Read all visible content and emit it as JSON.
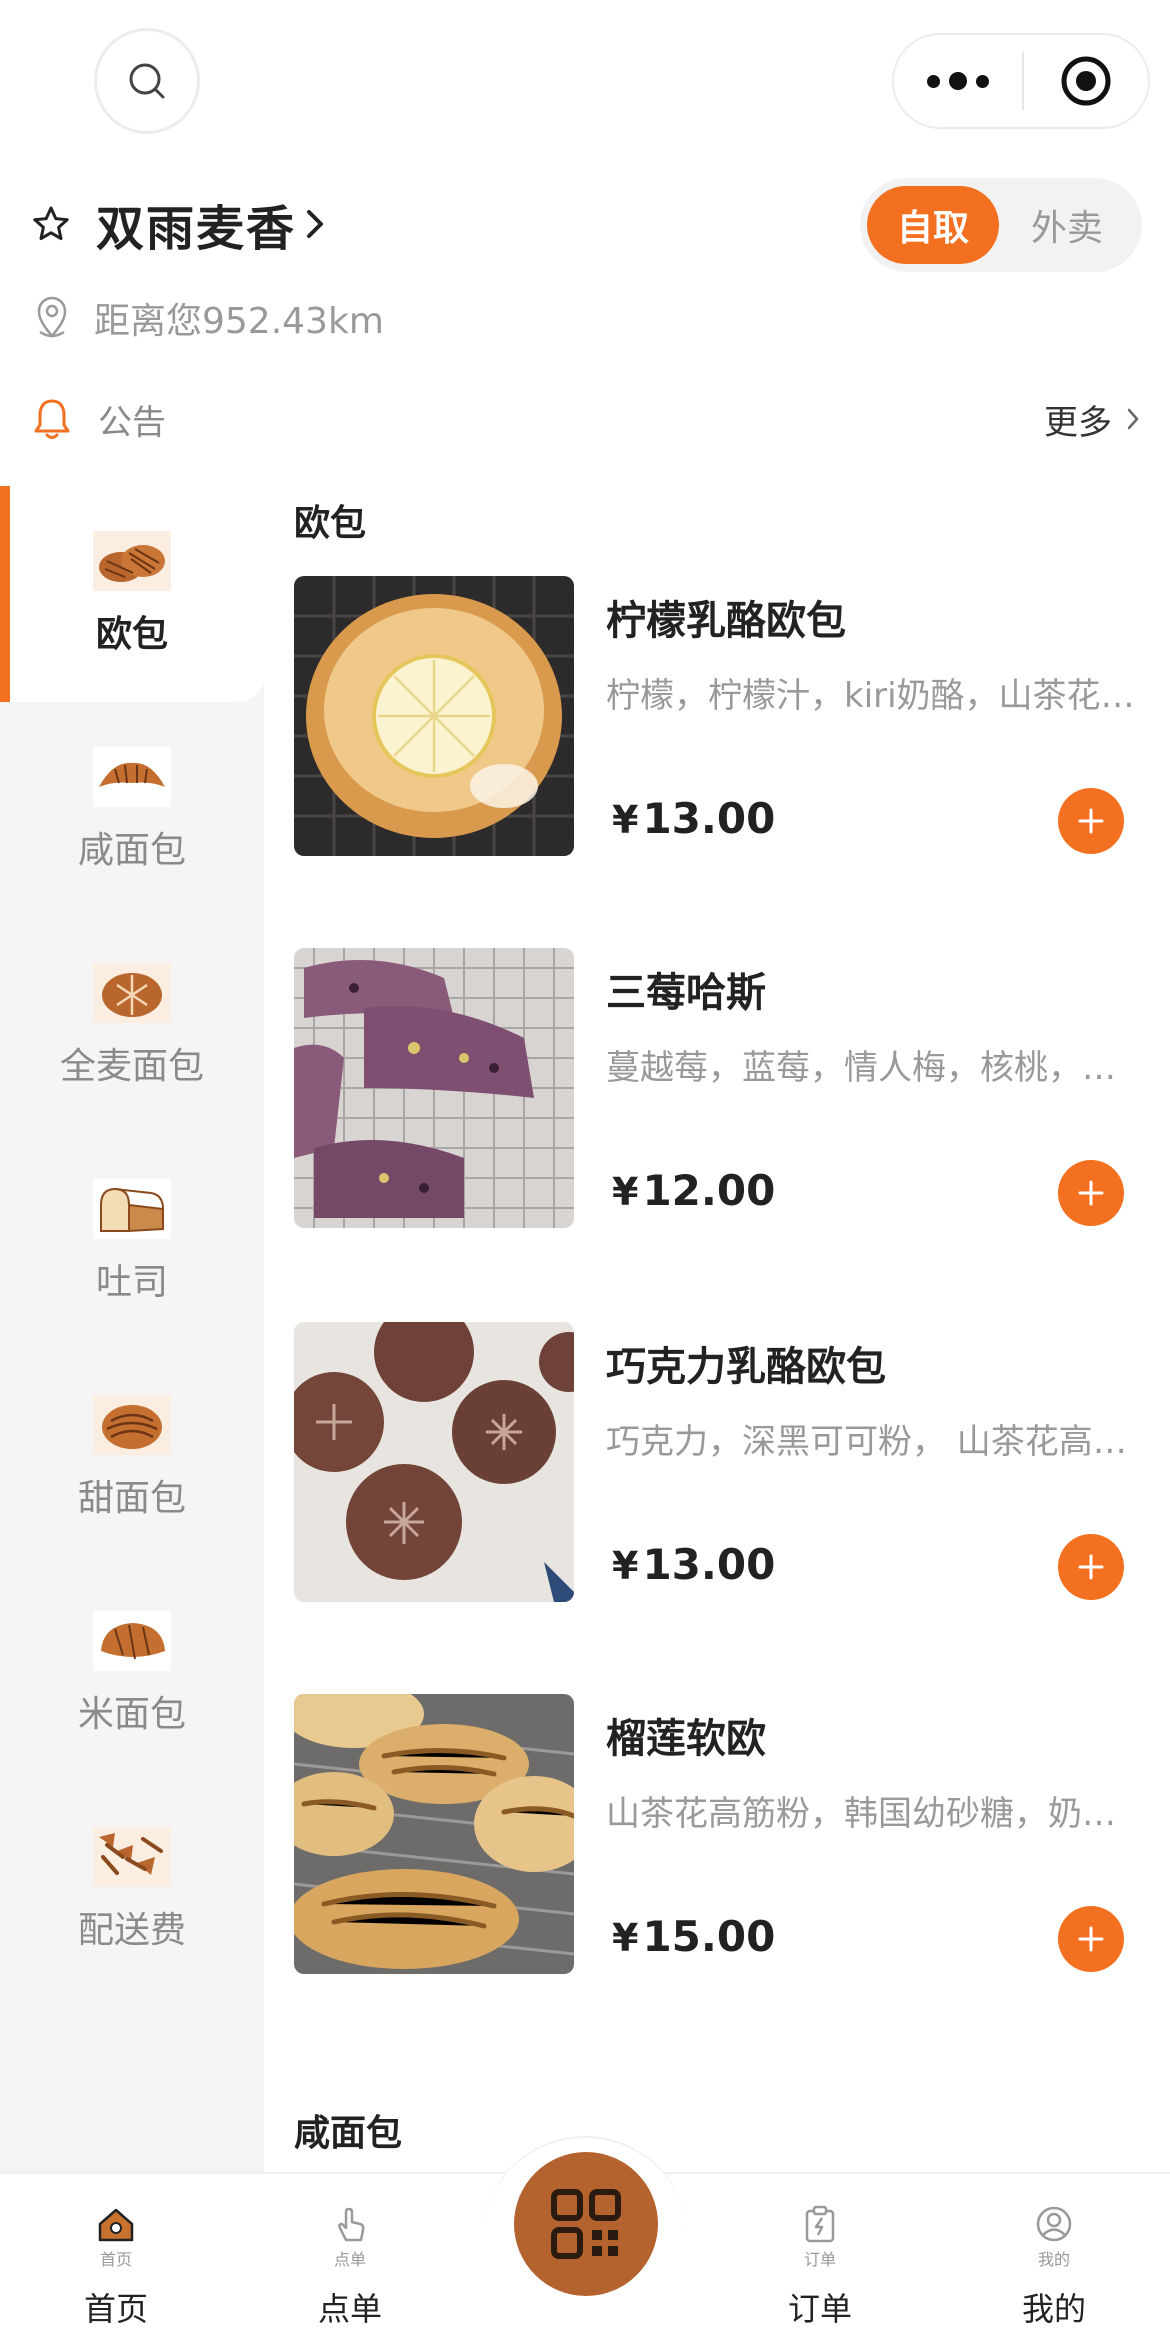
{
  "header": {
    "search_icon": "search-icon",
    "more_icon": "more-dots-icon",
    "close_icon": "target-icon"
  },
  "shop": {
    "name": "双雨麦香",
    "distance": "距离您952.43km",
    "mode_selected": "自取",
    "mode_other": "外卖",
    "notice_label": "公告",
    "notice_more": "更多"
  },
  "sidebar": {
    "items": [
      {
        "label": "欧包",
        "icon": "european-bread-icon",
        "active": true
      },
      {
        "label": "咸面包",
        "icon": "croissant-icon",
        "active": false
      },
      {
        "label": "全麦面包",
        "icon": "whole-wheat-loaf-icon",
        "active": false
      },
      {
        "label": "吐司",
        "icon": "toast-loaf-icon",
        "active": false
      },
      {
        "label": "甜面包",
        "icon": "sweet-bun-icon",
        "active": false
      },
      {
        "label": "米面包",
        "icon": "rice-bread-icon",
        "active": false
      },
      {
        "label": "配送费",
        "icon": "delivery-fee-icon",
        "active": false
      }
    ]
  },
  "sections": [
    {
      "title": "欧包",
      "products": [
        {
          "name": "柠檬乳酪欧包",
          "desc": "柠檬，柠檬汁，kiri奶酪，山茶花高筋粉",
          "currency": "¥",
          "price": "13.00"
        },
        {
          "name": "三莓哈斯",
          "desc": "蔓越莓，蓝莓，情人梅，核桃，全麦粉",
          "currency": "¥",
          "price": "12.00"
        },
        {
          "name": "巧克力乳酪欧包",
          "desc": "巧克力，深黑可可粉， 山茶花高筋粉",
          "currency": "¥",
          "price": "13.00"
        },
        {
          "name": "榴莲软欧",
          "desc": "山茶花高筋粉，韩国幼砂糖，奶油奶酪",
          "currency": "¥",
          "price": "15.00"
        }
      ]
    },
    {
      "title": "咸面包",
      "products": []
    }
  ],
  "tabbar": {
    "tabs": [
      {
        "label": "首页",
        "mini": "首页",
        "icon": "home-icon"
      },
      {
        "label": "点单",
        "mini": "点单",
        "icon": "tap-order-icon"
      },
      {
        "label": "订单",
        "mini": "订单",
        "icon": "clipboard-icon"
      },
      {
        "label": "我的",
        "mini": "我的",
        "icon": "user-icon"
      }
    ],
    "scan_icon": "qr-code-icon"
  },
  "colors": {
    "accent": "#f37021",
    "scan_button": "#b5632e",
    "sidebar_bg": "#f5f5f5",
    "muted_text": "#999999"
  }
}
